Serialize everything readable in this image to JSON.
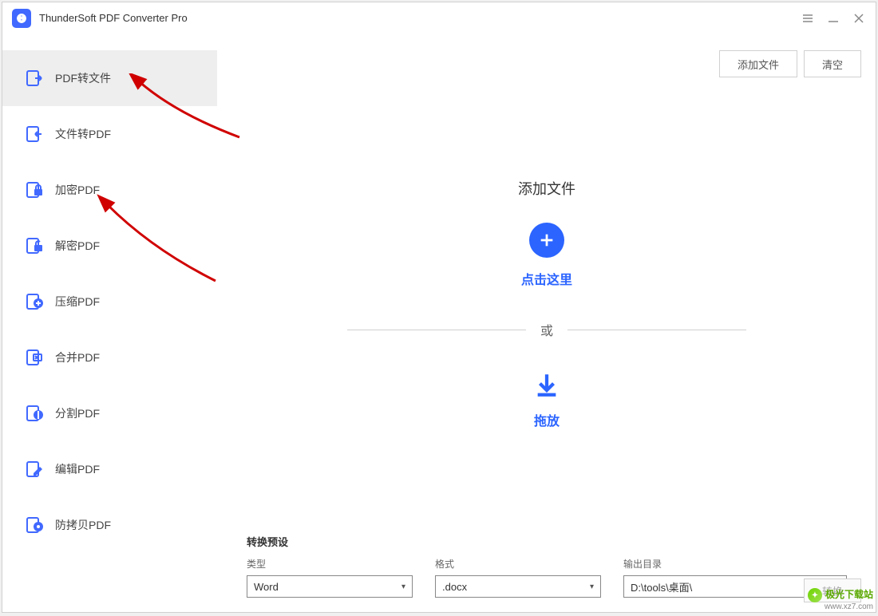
{
  "app": {
    "title": "ThunderSoft PDF Converter Pro"
  },
  "sidebar": {
    "items": [
      {
        "label": "PDF转文件"
      },
      {
        "label": "文件转PDF"
      },
      {
        "label": "加密PDF"
      },
      {
        "label": "解密PDF"
      },
      {
        "label": "压缩PDF"
      },
      {
        "label": "合并PDF"
      },
      {
        "label": "分割PDF"
      },
      {
        "label": "编辑PDF"
      },
      {
        "label": "防拷贝PDF"
      }
    ]
  },
  "toolbar": {
    "add_file": "添加文件",
    "clear": "清空"
  },
  "drop": {
    "title": "添加文件",
    "click_here": "点击这里",
    "or": "或",
    "drag": "拖放"
  },
  "presets": {
    "title": "转换预设",
    "type_label": "类型",
    "type_value": "Word",
    "format_label": "格式",
    "format_value": ".docx",
    "output_label": "输出目录",
    "output_value": "D:\\tools\\桌面\\"
  },
  "convert_label": "转换",
  "watermark": {
    "site": "极光下载站",
    "url": "www.xz7.com"
  }
}
